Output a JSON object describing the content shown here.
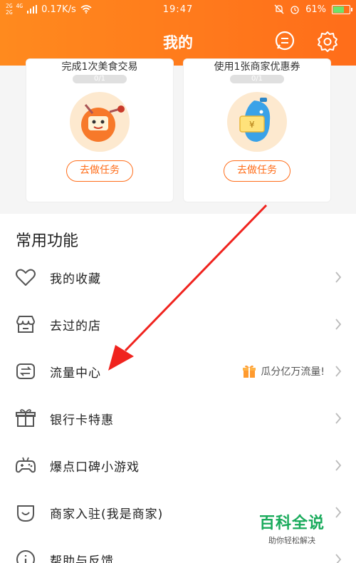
{
  "status_bar": {
    "network_top": "2G",
    "network_mid": "4G",
    "network_bot": "2G",
    "speed": "0.17K/s",
    "time": "19:47",
    "battery": "61%",
    "battery_level": 0.61
  },
  "header": {
    "title": "我的",
    "accent": "#ff7a1c",
    "message_icon": "chat-bubble-icon",
    "settings_icon": "gear-icon"
  },
  "tasks": [
    {
      "desc": "完成1次美食交易",
      "progress": "0/1",
      "button": "去做任务",
      "image": "food-mascot-icon"
    },
    {
      "desc": "使用1张商家优惠券",
      "progress": "0/1",
      "button": "去做任务",
      "image": "coupon-mascot-icon"
    }
  ],
  "common": {
    "title": "常用功能",
    "items": [
      {
        "label": "我的收藏",
        "icon": "heart-icon"
      },
      {
        "label": "去过的店",
        "icon": "shop-icon"
      },
      {
        "label": "流量中心",
        "icon": "data-swap-icon",
        "promo": "瓜分亿万流量!",
        "promo_icon": "gift-box-icon"
      },
      {
        "label": "银行卡特惠",
        "icon": "gift-icon"
      },
      {
        "label": "爆点口碑小游戏",
        "icon": "gamepad-icon"
      },
      {
        "label": "商家入驻(我是商家)",
        "icon": "merchant-icon"
      },
      {
        "label": "帮助与反馈",
        "icon": "help-icon"
      }
    ]
  },
  "watermark": {
    "main": "百科全说",
    "sub": "助你轻松解决"
  }
}
